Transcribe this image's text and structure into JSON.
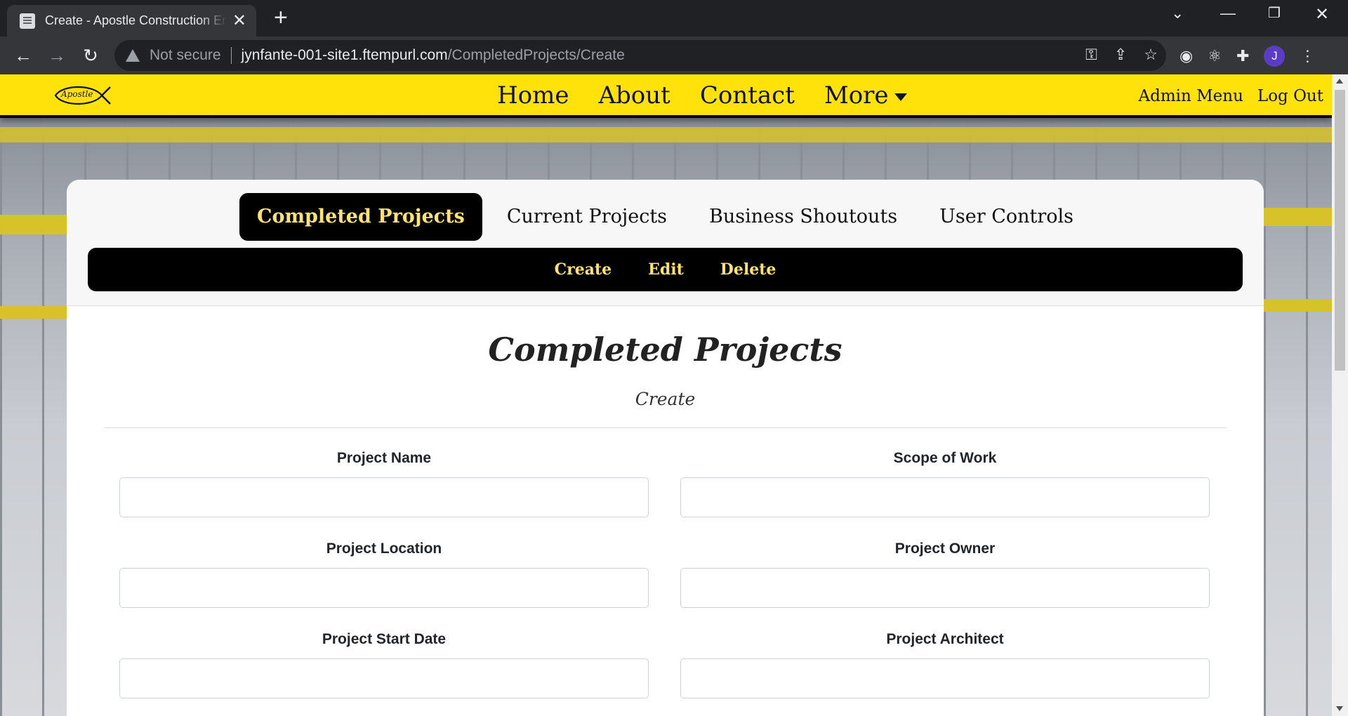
{
  "browser": {
    "tab_title": "Create - Apostle Construction Enterprises",
    "security_label": "Not secure",
    "url_host": "jynfante-001-site1.ftempurl.com",
    "url_path": "/CompletedProjects/Create",
    "profile_initial": "J"
  },
  "site": {
    "logo_text": "Apostle",
    "nav": {
      "home": "Home",
      "about": "About",
      "contact": "Contact",
      "more": "More",
      "admin_menu": "Admin Menu",
      "log_out": "Log Out"
    },
    "brand_color": "#ffe20a"
  },
  "admin": {
    "tabs": [
      "Completed Projects",
      "Current Projects",
      "Business Shoutouts",
      "User Controls"
    ],
    "active_tab": "Completed Projects",
    "actions": [
      "Create",
      "Edit",
      "Delete"
    ]
  },
  "form": {
    "title": "Completed Projects",
    "subtitle": "Create",
    "fields": {
      "project_name": "Project Name",
      "scope_of_work": "Scope of Work",
      "project_location": "Project Location",
      "project_owner": "Project Owner",
      "project_start_date": "Project Start Date",
      "project_architect": "Project Architect"
    }
  }
}
